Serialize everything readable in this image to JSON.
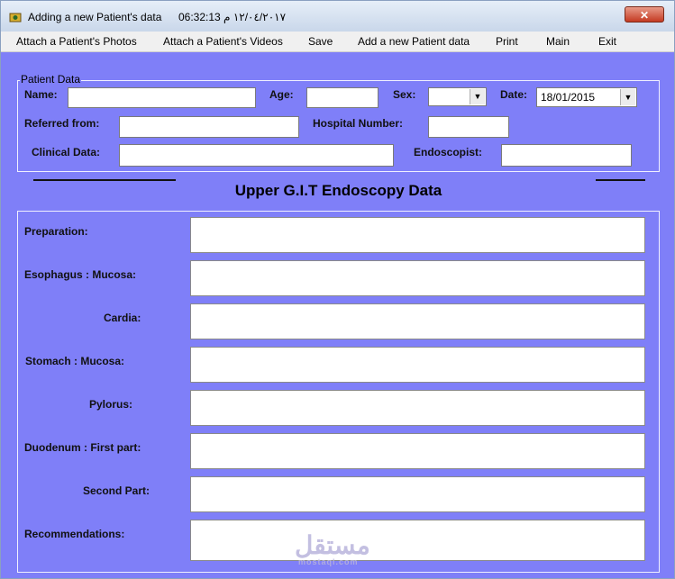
{
  "window": {
    "title": "Adding a new Patient's data",
    "clock": "06:32:13 ١٢/٠٤/٢٠١٧ م",
    "close_label": "✕"
  },
  "menu": {
    "items": [
      {
        "label": "Attach a Patient's Photos"
      },
      {
        "label": "Attach a Patient's Videos"
      },
      {
        "label": "Save"
      },
      {
        "label": "Add a new Patient data"
      },
      {
        "label": "Print"
      },
      {
        "label": "Main"
      },
      {
        "label": "Exit"
      }
    ]
  },
  "patient": {
    "group_label": "Patient Data",
    "name_label": "Name:",
    "name_value": "",
    "age_label": "Age:",
    "age_value": "",
    "sex_label": "Sex:",
    "sex_value": "",
    "date_label": "Date:",
    "date_value": "18/01/2015",
    "referred_label": "Referred from:",
    "referred_value": "",
    "hospital_label": "Hospital Number:",
    "hospital_value": "",
    "clinical_label": "Clinical Data:",
    "clinical_value": "",
    "endoscopist_label": "Endoscopist:",
    "endoscopist_value": ""
  },
  "section": {
    "title": "Upper G.I.T Endoscopy Data"
  },
  "fields": [
    {
      "label": "Preparation:",
      "value": ""
    },
    {
      "label": "Esophagus : Mucosa:",
      "value": ""
    },
    {
      "label": "Cardia:",
      "value": ""
    },
    {
      "label": "Stomach : Mucosa:",
      "value": ""
    },
    {
      "label": "Pylorus:",
      "value": ""
    },
    {
      "label": "Duodenum : First part:",
      "value": ""
    },
    {
      "label": "Second Part:",
      "value": ""
    },
    {
      "label": "Recommendations:",
      "value": ""
    }
  ],
  "watermark": {
    "text": "مستقل",
    "subtext": "mostaql.com"
  }
}
